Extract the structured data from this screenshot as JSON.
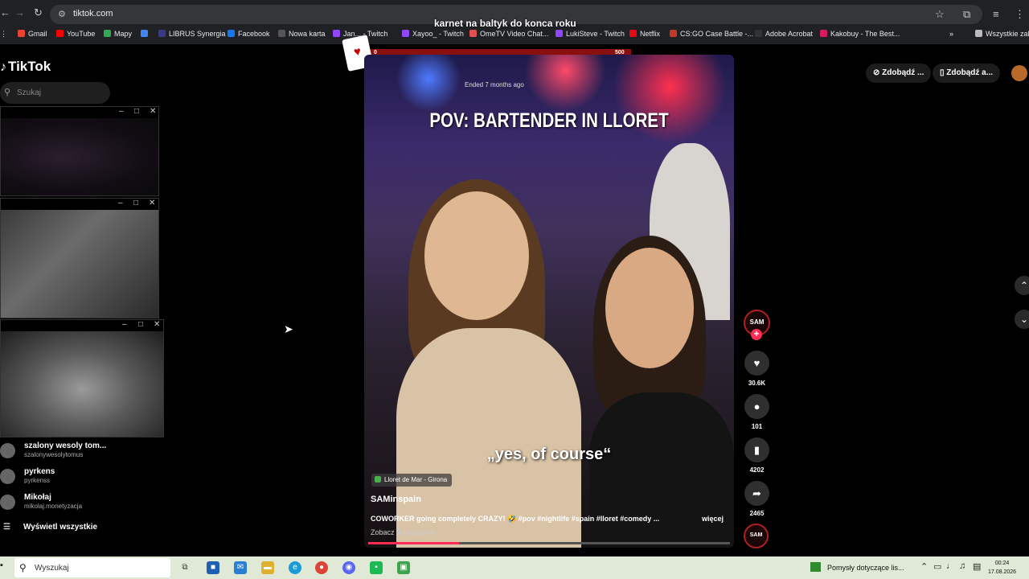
{
  "browser": {
    "url": "tiktok.com",
    "overlay_title": "karnet na baltyk do konca roku",
    "bookmarks": [
      {
        "label": "Gmail",
        "color": "#ea4335"
      },
      {
        "label": "YouTube",
        "color": "#ff0000"
      },
      {
        "label": "Mapy",
        "color": "#34a853"
      },
      {
        "label": "",
        "color": "#4285f4"
      },
      {
        "label": "LIBRUS Synergia",
        "color": "#3a3a8a"
      },
      {
        "label": "Facebook",
        "color": "#1877f2"
      },
      {
        "label": "Nowa karta",
        "color": "#555555"
      },
      {
        "label": "Jan... - Twitch",
        "color": "#9146ff"
      },
      {
        "label": "Xayoo_ - Twitch",
        "color": "#9146ff"
      },
      {
        "label": "OmeTV Video Chat...",
        "color": "#e05050"
      },
      {
        "label": "LukiSteve - Twitch",
        "color": "#9146ff"
      },
      {
        "label": "Netflix",
        "color": "#e50914"
      },
      {
        "label": "CS:GO Case Battle -...",
        "color": "#c0392b"
      },
      {
        "label": "Adobe Acrobat",
        "color": "#333333"
      },
      {
        "label": "Kakobuy - The Best...",
        "color": "#d81b60"
      }
    ],
    "bookmarks_all": "Wszystkie zak"
  },
  "tiktok": {
    "logo": "TikTok",
    "search_placeholder": "Szukaj",
    "get_app_1": "Zdobądź ...",
    "get_app_2": "Zdobądź a...",
    "accounts": [
      {
        "name": "szalony wesoly tom...",
        "handle": "szalonywesolytomus"
      },
      {
        "name": "pyrkens",
        "handle": "pyrkenss"
      },
      {
        "name": "Mikołaj",
        "handle": "mikolaj.monetyzacja"
      }
    ],
    "see_all": "Wyświetl wszystkie"
  },
  "overlay": {
    "left_value": "0",
    "right_value": "500"
  },
  "video": {
    "ended": "Ended 7 months ago",
    "headline": "POV: BARTENDER IN LLORET",
    "subtitle": "„yes, of course“",
    "location": "Lloret de Mar - Girona",
    "author": "SAMinspain",
    "description": "COWORKER going completely CRAZY! 🤣 #pov #nightlife #spain #lloret #comedy ...",
    "more": "więcej",
    "translate": "Zobacz tłumaczenie",
    "progress_fraction": 0.25
  },
  "actions": {
    "avatar_text": "SAM",
    "likes": "30.6K",
    "comments": "101",
    "saves": "4202",
    "shares": "2465"
  },
  "taskbar": {
    "search_placeholder": "Wyszukaj",
    "news": "Pomysły dotyczące lis...",
    "time": "00:24",
    "date": "17.08.2026"
  }
}
